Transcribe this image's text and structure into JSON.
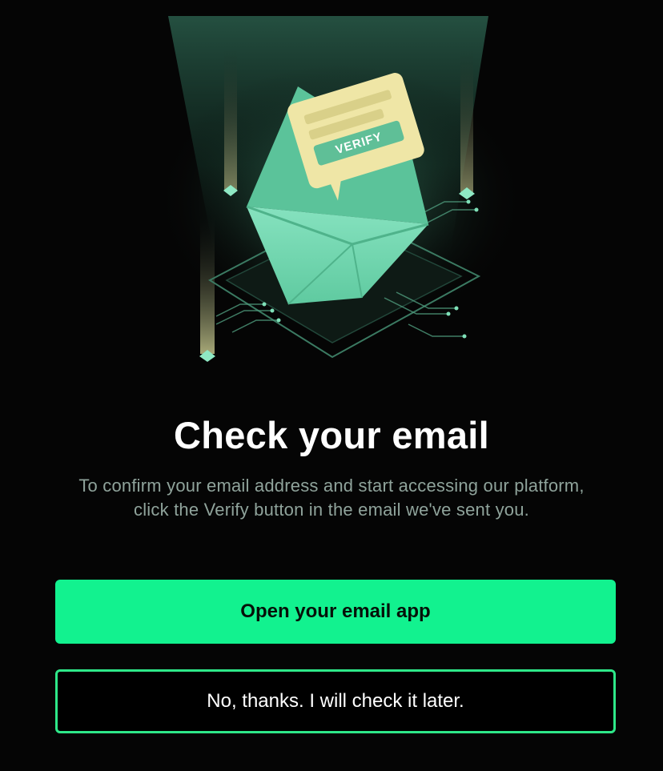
{
  "illustration": {
    "card_label": "VERIFY",
    "icon": "envelope-verify-icon"
  },
  "heading": "Check your email",
  "description": "To confirm your email address and start accessing our platform, click the Verify button in the email we've sent you.",
  "primary_button": "Open your email app",
  "secondary_button": "No, thanks. I will check it later.",
  "colors": {
    "background": "#050505",
    "accent": "#12f28f",
    "outline": "#2ee889",
    "envelope": "#6fd9ad",
    "card": "#efe6a6"
  }
}
